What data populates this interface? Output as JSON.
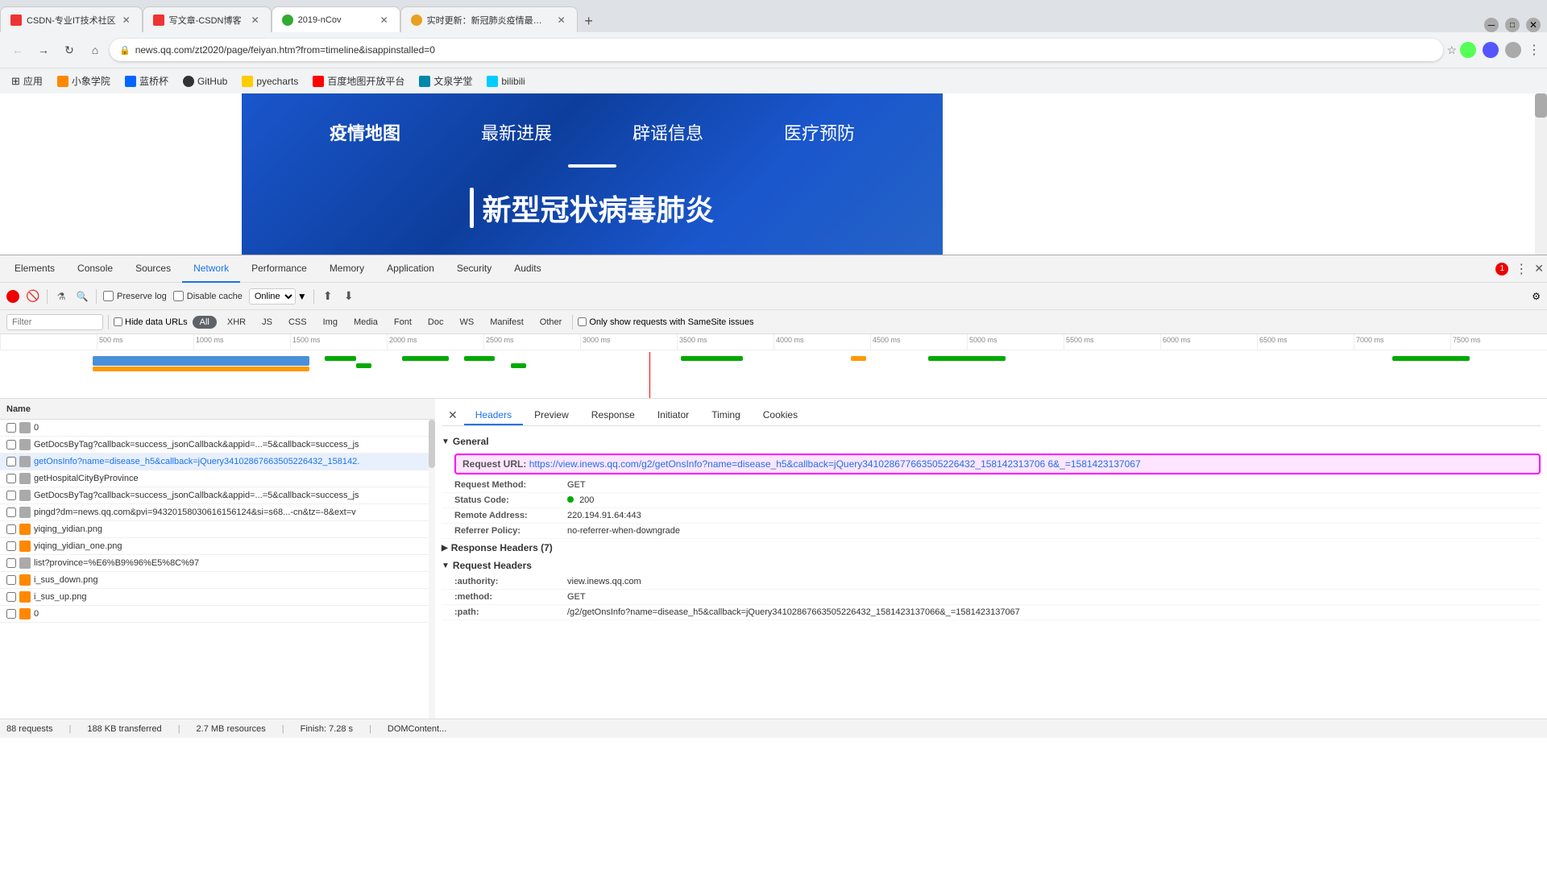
{
  "browser": {
    "tabs": [
      {
        "id": 1,
        "favicon_color": "#e33",
        "title": "CSDN-专业IT技术社区",
        "active": false
      },
      {
        "id": 2,
        "favicon_color": "#e33",
        "title": "写文章-CSDN博客",
        "active": false
      },
      {
        "id": 3,
        "favicon_color": "#3a3",
        "title": "2019-nCov",
        "active": true
      },
      {
        "id": 4,
        "favicon_color": "#e8a020",
        "title": "实时更新：新冠肺炎疫情最新动...",
        "active": false
      }
    ],
    "url": "news.qq.com/zt2020/page/feiyan.htm?from=timeline&isappinstalled=0",
    "bookmarks": [
      {
        "label": "应用",
        "icon": "grid"
      },
      {
        "label": "小象学院",
        "icon": "orange"
      },
      {
        "label": "蓝桥杯",
        "icon": "blue"
      },
      {
        "label": "GitHub",
        "icon": "github"
      },
      {
        "label": "pyecharts",
        "icon": "yellow"
      },
      {
        "label": "百度地图开放平台",
        "icon": "red"
      },
      {
        "label": "文泉学堂",
        "icon": "teal"
      },
      {
        "label": "bilibili",
        "icon": "cyan"
      }
    ]
  },
  "page": {
    "nav_items": [
      "疫情地图",
      "最新进展",
      "辟谣信息",
      "医疗预防"
    ],
    "title": "新型冠状病毒肺炎"
  },
  "devtools": {
    "tabs": [
      "Elements",
      "Console",
      "Sources",
      "Network",
      "Performance",
      "Memory",
      "Application",
      "Security",
      "Audits"
    ],
    "active_tab": "Network",
    "error_count": "1",
    "controls": {
      "preserve_log": "Preserve log",
      "disable_cache": "Disable cache",
      "online_label": "Online"
    },
    "filter": {
      "placeholder": "Filter",
      "hide_data_urls": "Hide data URLs",
      "types": [
        "All",
        "XHR",
        "JS",
        "CSS",
        "Img",
        "Media",
        "Font",
        "Doc",
        "WS",
        "Manifest",
        "Other"
      ],
      "same_site": "Only show requests with SameSite issues"
    },
    "timeline": {
      "ticks": [
        "500 ms",
        "1000 ms",
        "1500 ms",
        "2000 ms",
        "2500 ms",
        "3000 ms",
        "3500 ms",
        "4000 ms",
        "4500 ms",
        "5000 ms",
        "5500 ms",
        "6000 ms",
        "6500 ms",
        "7000 ms",
        "7500 ms"
      ]
    },
    "files": [
      {
        "name": "0",
        "color": "#aaa"
      },
      {
        "name": "GetDocsByTag?callback=success_jsonCallback&appid=...=5&callback=success_js",
        "color": "#aaa"
      },
      {
        "name": "getOnsInfo?name=disease_h5&callback=jQuery34102867663505226432_158142.",
        "color": "#aaa",
        "selected": true
      },
      {
        "name": "getHospitalCityByProvince",
        "color": "#aaa"
      },
      {
        "name": "GetDocsByTag?callback=success_jsonCallback&appid=...=5&callback=success_js",
        "color": "#aaa"
      },
      {
        "name": "pingd?dm=news.qq.com&pvi=94320158030616156124&si=s68...-cn&tz=-8&ext=v",
        "color": "#aaa"
      },
      {
        "name": "yiqing_yidian.png",
        "color": "#f80"
      },
      {
        "name": "yiqing_yidian_one.png",
        "color": "#f80"
      },
      {
        "name": "list?province=%E6%B9%96%E5%8C%97",
        "color": "#aaa"
      },
      {
        "name": "i_sus_down.png",
        "color": "#f80"
      },
      {
        "name": "i_sus_up.png",
        "color": "#f80"
      },
      {
        "name": "0",
        "color": "#aaa"
      }
    ],
    "status_bar": {
      "requests": "88 requests",
      "transferred": "188 KB transferred",
      "resources": "2.7 MB resources",
      "finish": "Finish: 7.28 s",
      "dom_content": "DOMContent..."
    },
    "detail": {
      "tabs": [
        "Headers",
        "Preview",
        "Response",
        "Initiator",
        "Timing",
        "Cookies"
      ],
      "active_tab": "Headers",
      "general": {
        "label": "General",
        "request_url": {
          "key": "Request URL:",
          "value": "https://view.inews.qq.com/g2/getOnsInfo?name=disease_h5&callback=jQuery341028677663505226432_158142313706 6&_=1581423137067"
        },
        "request_method": {
          "key": "Request Method:",
          "value": "GET"
        },
        "status_code": {
          "key": "Status Code:",
          "value": "200"
        },
        "remote_address": {
          "key": "Remote Address:",
          "value": "220.194.91.64:443"
        },
        "referrer_policy": {
          "key": "Referrer Policy:",
          "value": "no-referrer-when-downgrade"
        }
      },
      "response_headers": {
        "label": "Response Headers (7)",
        "collapsed": true
      },
      "request_headers": {
        "label": "Request Headers",
        "rows": [
          {
            "key": ":authority:",
            "value": "view.inews.qq.com"
          },
          {
            "key": ":method:",
            "value": "GET"
          },
          {
            "key": ":path:",
            "value": "/g2/getOnsInfo?name=disease_h5&callback=jQuery34102867663505226432_1581423137066&_=1581423137067"
          }
        ]
      }
    }
  }
}
